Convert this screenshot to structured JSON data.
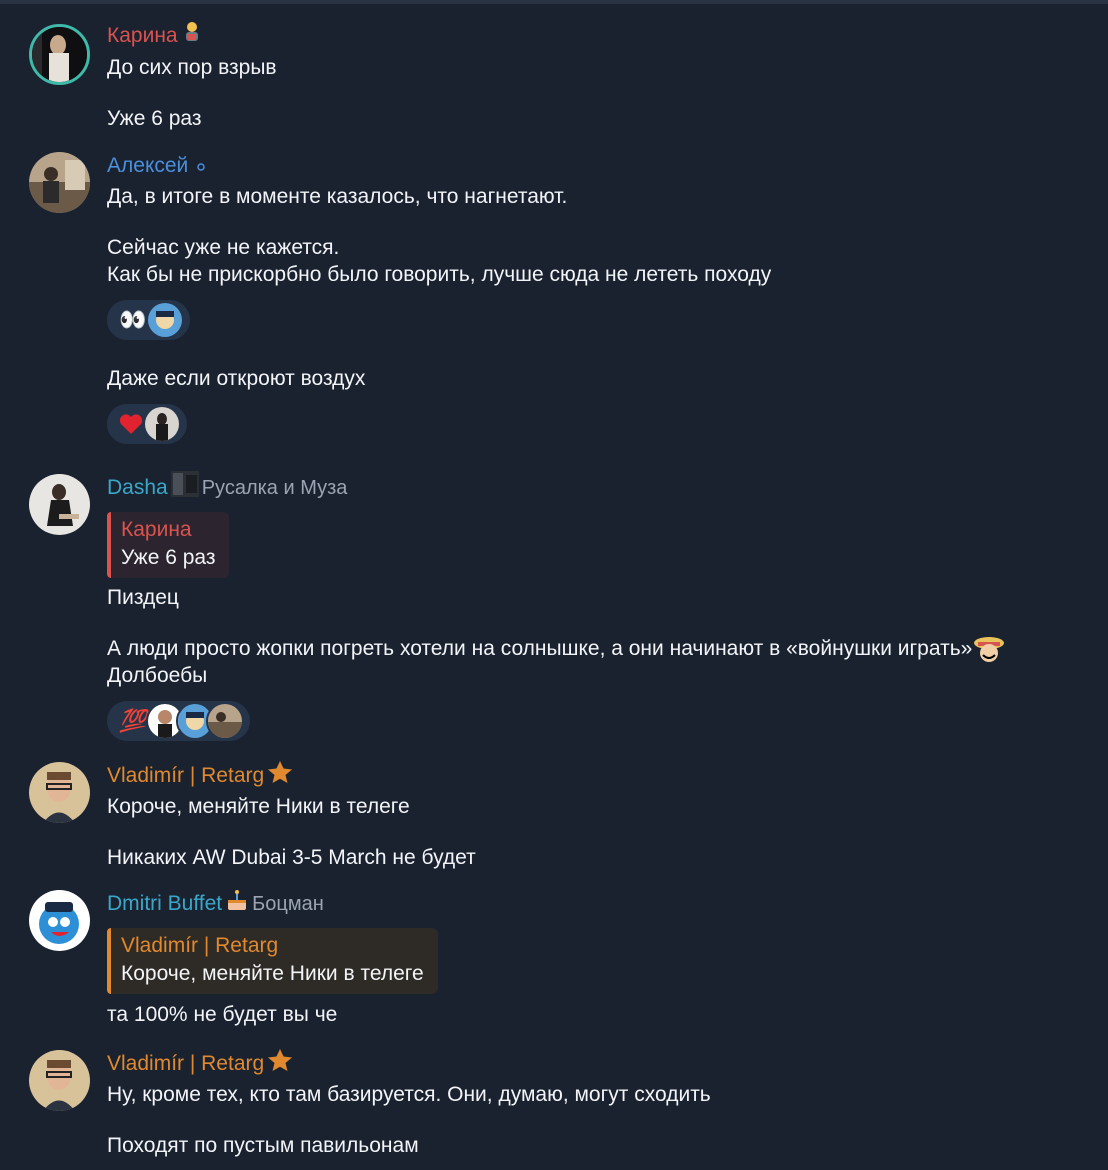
{
  "colors": {
    "background": "#1a2230",
    "karina": "#d9534f",
    "aleksey": "#4a8fdc",
    "dasha": "#3aa7c9",
    "vladimir": "#e0892e",
    "dmitri": "#3aa7c9",
    "reaction_bg": "#26344a"
  },
  "messages": [
    {
      "sender": "Карина",
      "badge_icon": "person-emoji-icon",
      "lines": [
        "До сих пор взрыв",
        "",
        "Уже 6 раз"
      ]
    },
    {
      "sender": "Алексей",
      "badge_icon": "small-circle-icon",
      "lines": [
        "Да, в итоге в моменте казалось, что нагнетают.",
        "",
        "Сейчас уже не кажется.",
        "Как бы не прискорбно было говорить, лучше сюда не лететь походу"
      ],
      "reactions1": {
        "emoji": "👀"
      },
      "line_after": "Даже если откроют воздух",
      "reactions2": {
        "emoji": "❤️"
      }
    },
    {
      "sender": "Dasha",
      "title": "Русалка и Муза",
      "quote": {
        "name": "Карина",
        "text": "Уже 6 раз"
      },
      "lines": [
        "Пиздец",
        "",
        "А люди просто жопки погреть хотели на солнышке, а они начинают в «войнушки играть»",
        "Долбоебы"
      ],
      "reactions": {
        "emoji": "💯"
      }
    },
    {
      "sender": "Vladimír | Retarg",
      "badge_icon": "star-icon",
      "lines": [
        "Короче, меняйте Ники в телеге",
        "",
        "Никаких AW Dubai 3-5 March не будет"
      ]
    },
    {
      "sender": "Dmitri Buffet",
      "title": "Боцман",
      "quote": {
        "name": "Vladimír | Retarg",
        "text": "Короче, меняйте Ники в телеге"
      },
      "lines": [
        "та 100% не будет вы че"
      ]
    },
    {
      "sender": "Vladimír | Retarg",
      "badge_icon": "star-icon",
      "lines": [
        "Ну, кроме тех, кто там базируется. Они, думаю, могут сходить",
        "",
        "Походят по пустым павильонам"
      ]
    }
  ]
}
